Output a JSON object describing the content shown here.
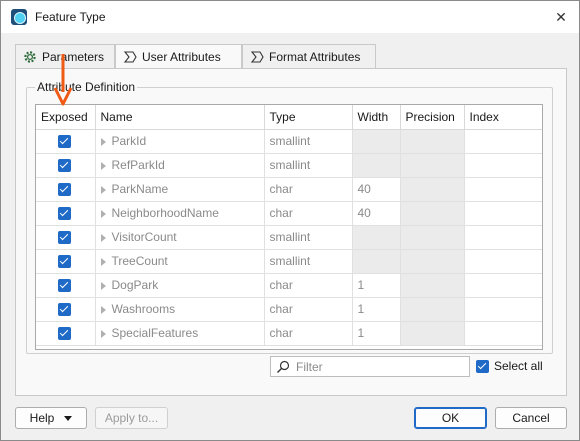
{
  "window": {
    "title": "Feature Type"
  },
  "tabs": [
    {
      "label": "Parameters",
      "icon": "gear-icon"
    },
    {
      "label": "User Attributes",
      "icon": "sigma-icon",
      "active": true
    },
    {
      "label": "Format Attributes",
      "icon": "sigma-icon"
    }
  ],
  "attribute_definition": {
    "legend": "Attribute Definition",
    "columns": [
      "Exposed",
      "Name",
      "Type",
      "Width",
      "Precision",
      "Index"
    ],
    "rows": [
      {
        "exposed": true,
        "name": "ParkId",
        "type": "smallint",
        "width": "",
        "precision": "",
        "index": ""
      },
      {
        "exposed": true,
        "name": "RefParkId",
        "type": "smallint",
        "width": "",
        "precision": "",
        "index": ""
      },
      {
        "exposed": true,
        "name": "ParkName",
        "type": "char",
        "width": "40",
        "precision": "",
        "index": ""
      },
      {
        "exposed": true,
        "name": "NeighborhoodName",
        "type": "char",
        "width": "40",
        "precision": "",
        "index": ""
      },
      {
        "exposed": true,
        "name": "VisitorCount",
        "type": "smallint",
        "width": "",
        "precision": "",
        "index": ""
      },
      {
        "exposed": true,
        "name": "TreeCount",
        "type": "smallint",
        "width": "",
        "precision": "",
        "index": ""
      },
      {
        "exposed": true,
        "name": "DogPark",
        "type": "char",
        "width": "1",
        "precision": "",
        "index": ""
      },
      {
        "exposed": true,
        "name": "Washrooms",
        "type": "char",
        "width": "1",
        "precision": "",
        "index": ""
      },
      {
        "exposed": true,
        "name": "SpecialFeatures",
        "type": "char",
        "width": "1",
        "precision": "",
        "index": ""
      }
    ]
  },
  "filter": {
    "placeholder": "Filter",
    "value": ""
  },
  "select_all": {
    "label": "Select all",
    "checked": true
  },
  "buttons": {
    "help": "Help",
    "apply": "Apply to...",
    "ok": "OK",
    "cancel": "Cancel"
  },
  "colors": {
    "accent": "#1f69c7",
    "annotation_arrow": "#f05a14"
  }
}
